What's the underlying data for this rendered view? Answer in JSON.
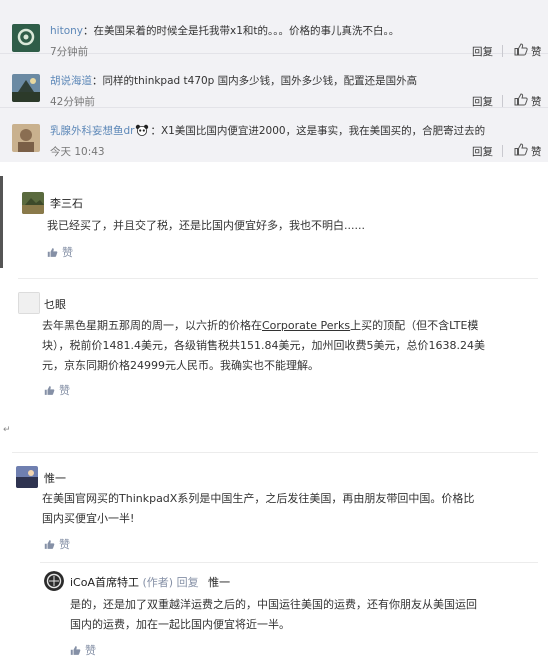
{
  "top_comments": [
    {
      "user": "hitony",
      "text": "：在美国呆着的时候全是托我带x1和t的。。。价格的事儿真洗不白。。",
      "time": "7分钟前",
      "reply_label": "回复",
      "like_label": "赞",
      "avatar_color": "#2f5d48"
    },
    {
      "user": "胡说海道",
      "text": "：同样的thinkpad t470p 国内多少钱，国外多少钱，配置还是国外高",
      "time": "42分钟前",
      "reply_label": "回复",
      "like_label": "赞",
      "avatar_color": "#3a4f5e"
    },
    {
      "user": "乳腺外科妄想鱼dr",
      "text": "：X1美国比国内便宜进2000，这是事实，我在美国买的，合肥寄过去的",
      "time": "今天 10:43",
      "reply_label": "回复",
      "like_label": "赞",
      "avatar_color": "#b59a76"
    }
  ],
  "answers": [
    {
      "name": "李三石",
      "body_lines": [
        "我已经买了，并且交了税，还是比国内便宜好多，我也不明白......"
      ],
      "like_label": "赞"
    },
    {
      "name": "乜眼",
      "body_lines": [
        "去年黑色星期五那周的周一，以六折的价格在Corporate Perks上买的顶配（但不含LTE模",
        "块），税前价1481.4美元，各级销售税共151.84美元，加州回收费5美元，总价1638.24美",
        "元，京东同期价格24999元人民币。我确实也不能理解。"
      ],
      "link_text": "Corporate Perks",
      "like_label": "赞"
    },
    {
      "name": "惟一",
      "body_lines": [
        "在美国官网买的ThinkpadX系列是中国生产，之后发往美国，再由朋友带回中国。价格比",
        "国内买便宜小一半!"
      ],
      "like_label": "赞"
    }
  ],
  "reply": {
    "name": "iCoA首席特工",
    "author_tag": "(作者)",
    "reply_word": "回复",
    "reply_target": "惟一",
    "body_lines": [
      "是的，还是加了双重越洋运费之后的，中国运往美国的运费，还有你朋友从美国运回",
      "国内的运费，加在一起比国内便宜将近一半。"
    ],
    "like_label": "赞"
  },
  "return_mark": "↵",
  "colors": {
    "panel_bg": "#f2f2f5",
    "weibo_link": "#5d88b8",
    "zhihu_meta": "#8590a6"
  }
}
